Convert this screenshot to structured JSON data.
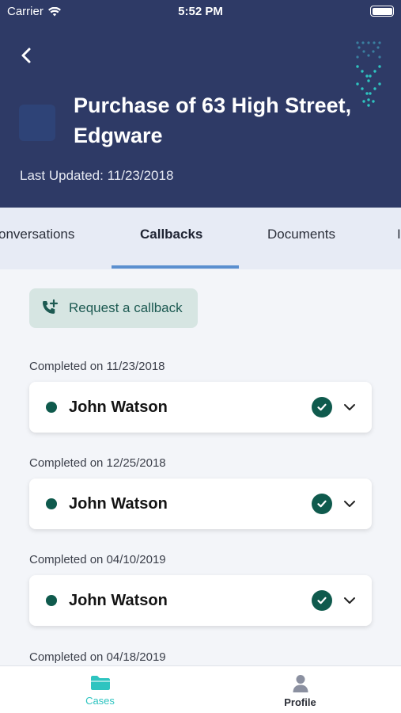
{
  "status_bar": {
    "carrier": "Carrier",
    "time": "5:52 PM"
  },
  "header": {
    "title": "Purchase of 63 High Street, Edgware",
    "last_updated": "Last Updated: 11/23/2018"
  },
  "tabs": [
    {
      "label": "onversations"
    },
    {
      "label": "Callbacks",
      "active": true
    },
    {
      "label": "Documents"
    },
    {
      "label": "I"
    }
  ],
  "actions": {
    "request_callback": "Request a callback"
  },
  "callbacks": [
    {
      "completed": "Completed on 11/23/2018",
      "name": "John Watson"
    },
    {
      "completed": "Completed on 12/25/2018",
      "name": "John Watson"
    },
    {
      "completed": "Completed on 04/10/2019",
      "name": "John Watson"
    },
    {
      "completed": "Completed on 04/18/2019",
      "name": ""
    }
  ],
  "tabbar": [
    {
      "label": "Cases",
      "icon": "folder-icon",
      "active": true
    },
    {
      "label": "Profile",
      "icon": "person-icon",
      "active": false
    }
  ],
  "colors": {
    "header_bg": "#2e3a66",
    "accent_green": "#0f5a4d",
    "teal_active": "#2ec4c0",
    "tab_indicator": "#5b8fcf"
  }
}
